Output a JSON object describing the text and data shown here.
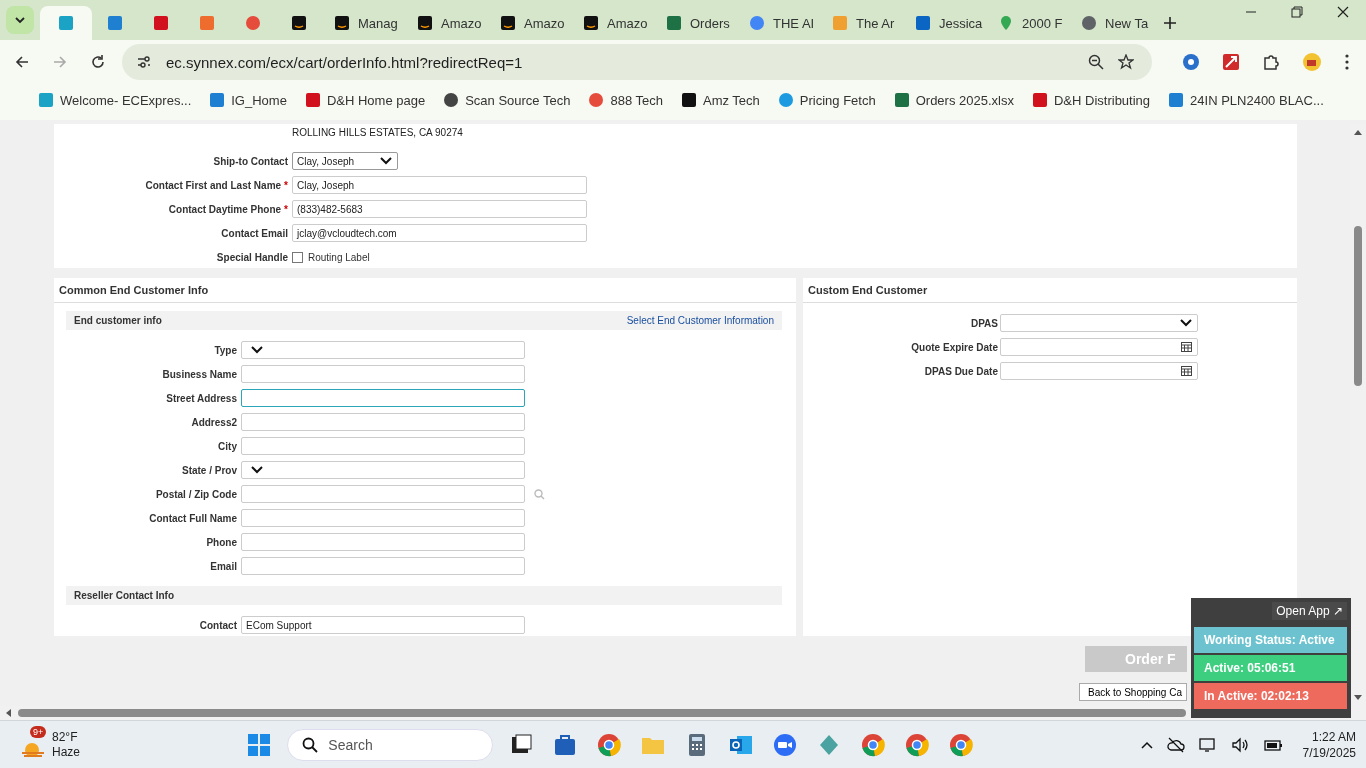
{
  "tabs": [
    {
      "kind": "ec",
      "selected": true
    },
    {
      "kind": "ig",
      "selected": false
    },
    {
      "kind": "dh",
      "selected": false
    },
    {
      "kind": "s",
      "selected": false
    },
    {
      "kind": "rings",
      "selected": false
    },
    {
      "kind": "amazon",
      "selected": false
    },
    {
      "kind": "amazon",
      "title": "Manag",
      "selected": false
    },
    {
      "kind": "amazon",
      "title": "Amazo",
      "selected": false
    },
    {
      "kind": "amazon",
      "title": "Amazo",
      "selected": false
    },
    {
      "kind": "amazon",
      "title": "Amazo",
      "selected": false
    },
    {
      "kind": "excel",
      "title": "Orders",
      "selected": false
    },
    {
      "kind": "google",
      "title": "THE AI",
      "selected": false
    },
    {
      "kind": "generic",
      "title": "The Ar",
      "selected": false
    },
    {
      "kind": "linkedin",
      "title": "Jessica",
      "selected": false
    },
    {
      "kind": "maps",
      "title": "2000 F",
      "selected": false
    },
    {
      "kind": "chrome",
      "title": "New Ta",
      "selected": false
    }
  ],
  "address_bar": {
    "url": "ec.synnex.com/ecx/cart/orderInfo.html?redirectReq=1"
  },
  "bookmarks": [
    {
      "kind": "ec",
      "label": "Welcome- ECExpres..."
    },
    {
      "kind": "ig",
      "label": "IG_Home"
    },
    {
      "kind": "dh",
      "label": "D&H Home page"
    },
    {
      "kind": "globe",
      "label": "Scan Source Tech"
    },
    {
      "kind": "rings",
      "label": "888 Tech"
    },
    {
      "kind": "amazon",
      "label": "Amz Tech"
    },
    {
      "kind": "pricing",
      "label": "Pricing Fetch"
    },
    {
      "kind": "excel",
      "label": "Orders 2025.xlsx"
    },
    {
      "kind": "dh",
      "label": "D&H Distributing"
    },
    {
      "kind": "ig",
      "label": "24IN PLN2400 BLAC..."
    }
  ],
  "ship_to": {
    "address_line": "ROLLING HILLS ESTATES, CA 90274",
    "fields": [
      {
        "label": "Ship-to Contact",
        "kind": "select",
        "value": "Clay, Joseph"
      },
      {
        "label": "Contact First and Last Name",
        "required_mark": "*",
        "kind": "text",
        "value": "Clay, Joseph"
      },
      {
        "label": "Contact Daytime Phone",
        "required_mark": "*",
        "kind": "text",
        "value": "(833)482-5683"
      },
      {
        "label": "Contact Email",
        "kind": "text",
        "value": "jclay@vcloudtech.com"
      },
      {
        "label": "Special Handle",
        "kind": "checkbox",
        "option": "Routing Label",
        "checked": false
      }
    ]
  },
  "common_end_customer": {
    "title": "Common End Customer Info",
    "subheader": "End customer info",
    "link": "Select End Customer Information",
    "fields": [
      {
        "label": "Type",
        "kind": "select",
        "focused": false
      },
      {
        "label": "Business Name",
        "kind": "text",
        "focused": false
      },
      {
        "label": "Street Address",
        "kind": "text",
        "focused": true
      },
      {
        "label": "Address2",
        "kind": "text",
        "focused": false
      },
      {
        "label": "City",
        "kind": "text",
        "focused": false
      },
      {
        "label": "State / Prov",
        "kind": "select",
        "focused": false
      },
      {
        "label": "Postal / Zip Code",
        "kind": "lookup",
        "focused": false
      },
      {
        "label": "Contact Full Name",
        "kind": "text",
        "focused": false
      },
      {
        "label": "Phone",
        "kind": "text",
        "focused": false
      },
      {
        "label": "Email",
        "kind": "text",
        "focused": false
      }
    ],
    "reseller_subheader": "Reseller Contact Info",
    "reseller_fields": [
      {
        "label": "Contact",
        "kind": "text",
        "focused": false,
        "value": "ECom Support"
      }
    ]
  },
  "custom_end_customer": {
    "title": "Custom End Customer",
    "fields": [
      {
        "label": "DPAS",
        "kind": "select"
      },
      {
        "label": "Quote Expire Date",
        "kind": "date"
      },
      {
        "label": "DPAS Due Date",
        "kind": "date"
      }
    ]
  },
  "buttons": {
    "order": "Order F",
    "back": "Back to Shopping Ca"
  },
  "status_widget": {
    "open_app": "Open App ↗",
    "working_status": "Working Status: Active",
    "active": "Active: 05:06:51",
    "inactive": "In Active: 02:02:13"
  },
  "taskbar": {
    "badge": "9+",
    "temperature": "82°F",
    "weather": "Haze",
    "search_placeholder": "Search",
    "time": "1:22 AM",
    "date": "7/19/2025"
  }
}
